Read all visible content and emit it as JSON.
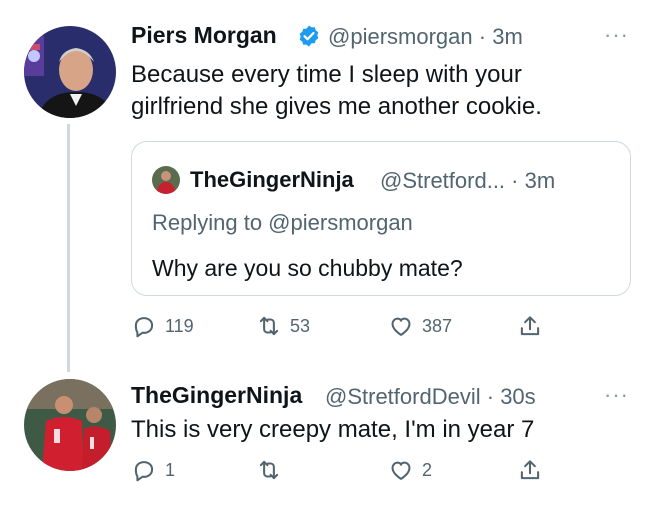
{
  "tweet1": {
    "name": "Piers Morgan",
    "handle": "@piersmorgan",
    "sep": "·",
    "time": "3m",
    "line1": "Because every time I sleep with your",
    "line2": "girlfriend she gives me another cookie.",
    "more": "···"
  },
  "quote": {
    "name": "TheGingerNinja",
    "handle": "@Stretford...",
    "sep": "·",
    "time": "3m",
    "replying": "Replying to @piersmorgan",
    "text": "Why are you so chubby mate?"
  },
  "tweet1_actions": {
    "replies": "119",
    "retweets": "53",
    "likes": "387"
  },
  "tweet2": {
    "name": "TheGingerNinja",
    "handle": "@StretfordDevil",
    "sep": "·",
    "time": "30s",
    "text": "This is very creepy mate, I'm in year 7",
    "more": "···"
  },
  "tweet2_actions": {
    "replies": "1",
    "retweets": "",
    "likes": "2"
  },
  "icons": [
    "verified-badge-icon",
    "reply-icon",
    "retweet-icon",
    "like-icon",
    "share-icon",
    "more-icon"
  ],
  "colors": {
    "verified": "#1d9bf0",
    "text": "#0f1419",
    "muted": "#536471",
    "border": "#cfd9de"
  }
}
